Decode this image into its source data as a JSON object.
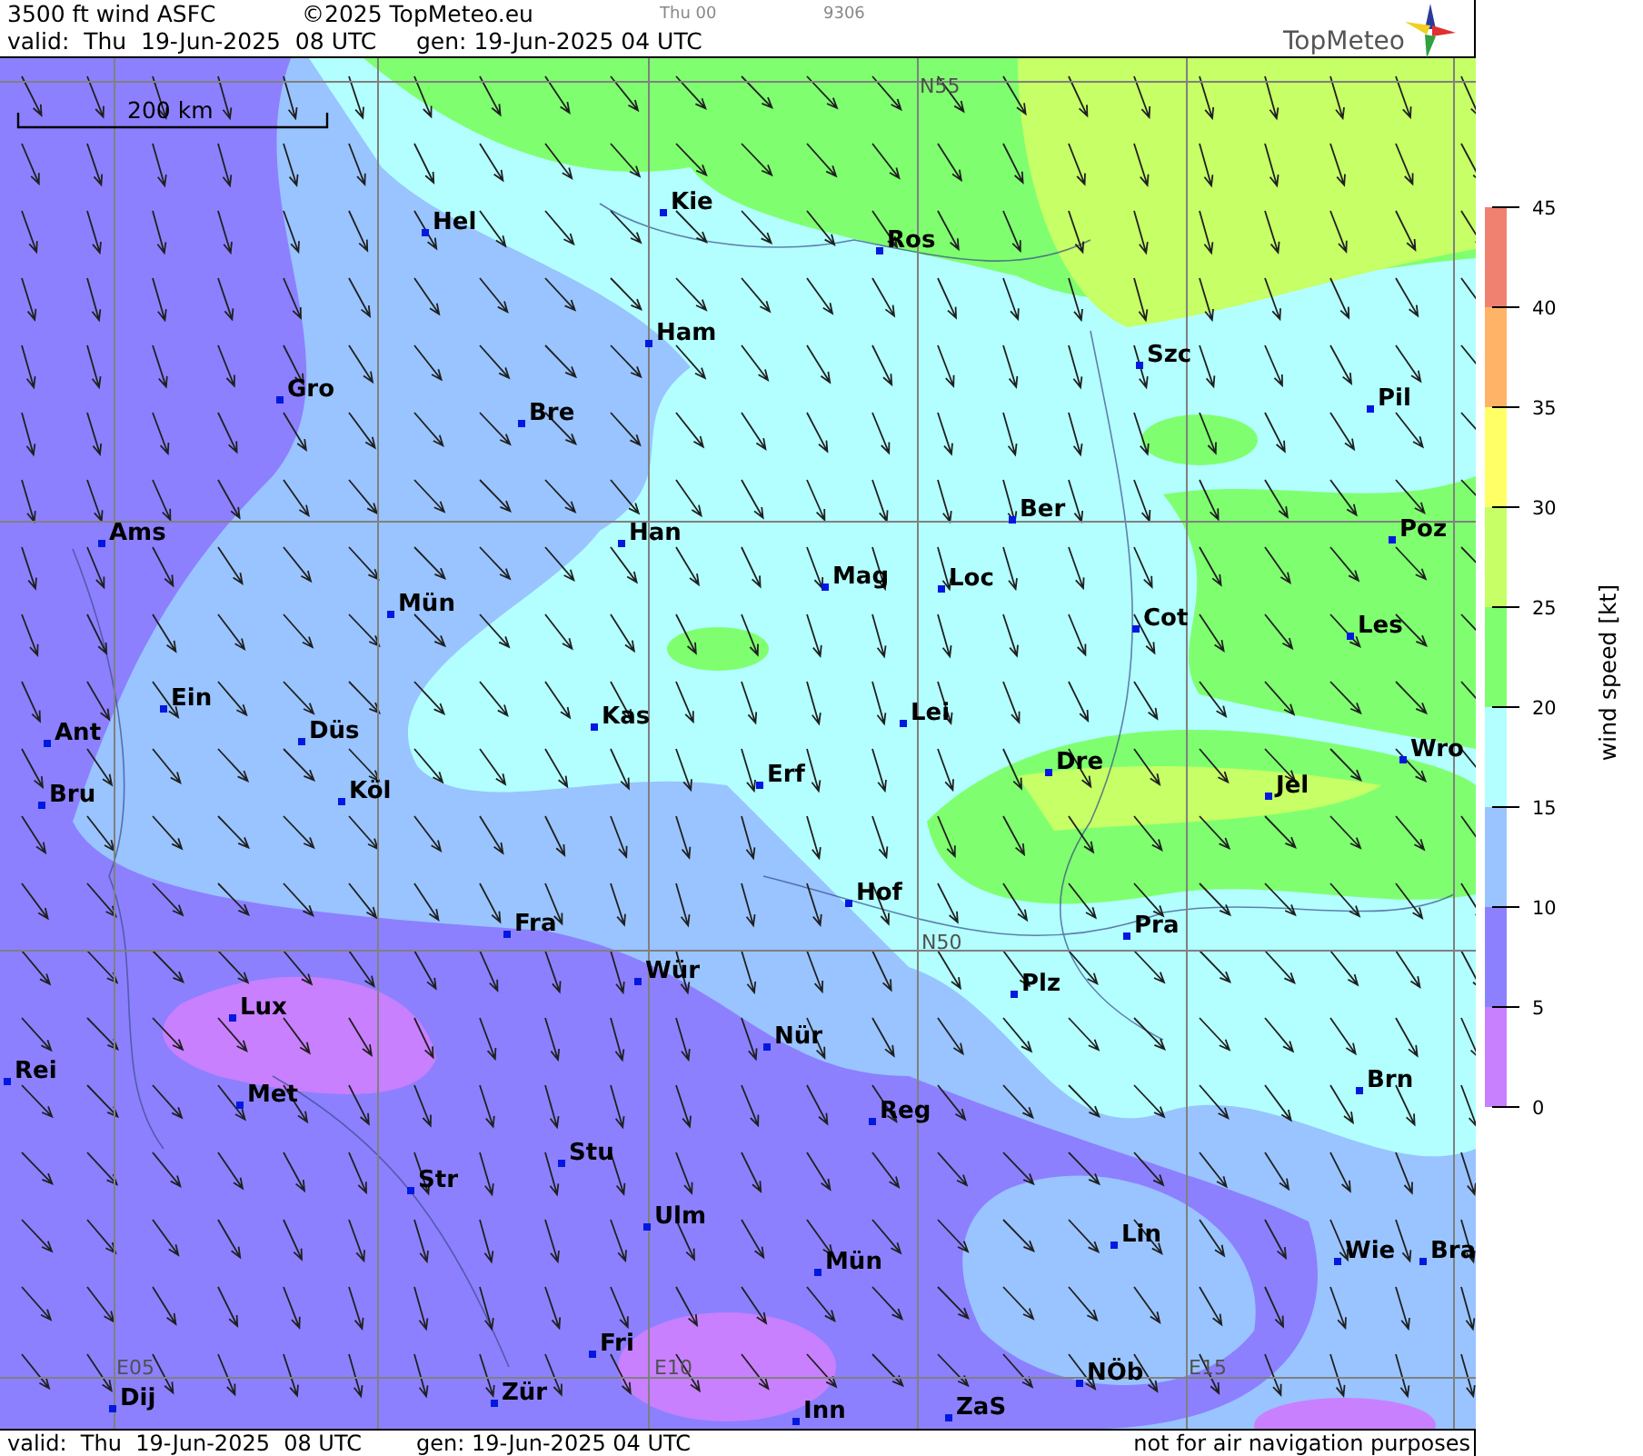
{
  "header": {
    "title": "3500 ft wind ASFC",
    "copyright": "©2025 TopMeteo.eu",
    "run_label": "Thu 00",
    "code": "9306",
    "valid": "valid:  Thu  19-Jun-2025  08 UTC",
    "gen": "gen: 19-Jun-2025 04 UTC",
    "logo_text": "TopMeteo"
  },
  "map": {
    "scale_label": "200 km",
    "grid_labels": [
      "N55",
      "N50",
      "E05",
      "E10",
      "E15"
    ],
    "cities": [
      "Hel",
      "Kie",
      "Ros",
      "Ham",
      "Gro",
      "Bre",
      "Szc",
      "Pil",
      "Ams",
      "Han",
      "Ber",
      "Poz",
      "Mün",
      "Mag",
      "Loc",
      "Cot",
      "Les",
      "Ein",
      "Ant",
      "Düs",
      "Kas",
      "Lei",
      "Bru",
      "Köl",
      "Erf",
      "Dre",
      "Jel",
      "Wro",
      "Hof",
      "Fra",
      "Pra",
      "Wür",
      "Plz",
      "Lux",
      "Nür",
      "Rei",
      "Met",
      "Reg",
      "Brn",
      "Stu",
      "Str",
      "Ulm",
      "Lin",
      "Wie",
      "Bra",
      "Mün",
      "Fri",
      "NÖb",
      "Dij",
      "Zür",
      "Inn",
      "ZaS"
    ]
  },
  "legend": {
    "title": "wind speed [kt]",
    "ticks": [
      "45",
      "40",
      "35",
      "30",
      "25",
      "20",
      "15",
      "10",
      "5",
      "0"
    ],
    "bands": [
      {
        "color": "#f08070"
      },
      {
        "color": "#ffb366"
      },
      {
        "color": "#ffff66"
      },
      {
        "color": "#c6ff66"
      },
      {
        "color": "#7fff6f"
      },
      {
        "color": "#b3ffff"
      },
      {
        "color": "#99c4ff"
      },
      {
        "color": "#8c80ff"
      },
      {
        "color": "#c880ff"
      }
    ]
  },
  "footer": {
    "valid": "valid:  Thu  19-Jun-2025  08 UTC",
    "gen": "gen: 19-Jun-2025 04 UTC",
    "note": "not for air navigation purposes"
  }
}
